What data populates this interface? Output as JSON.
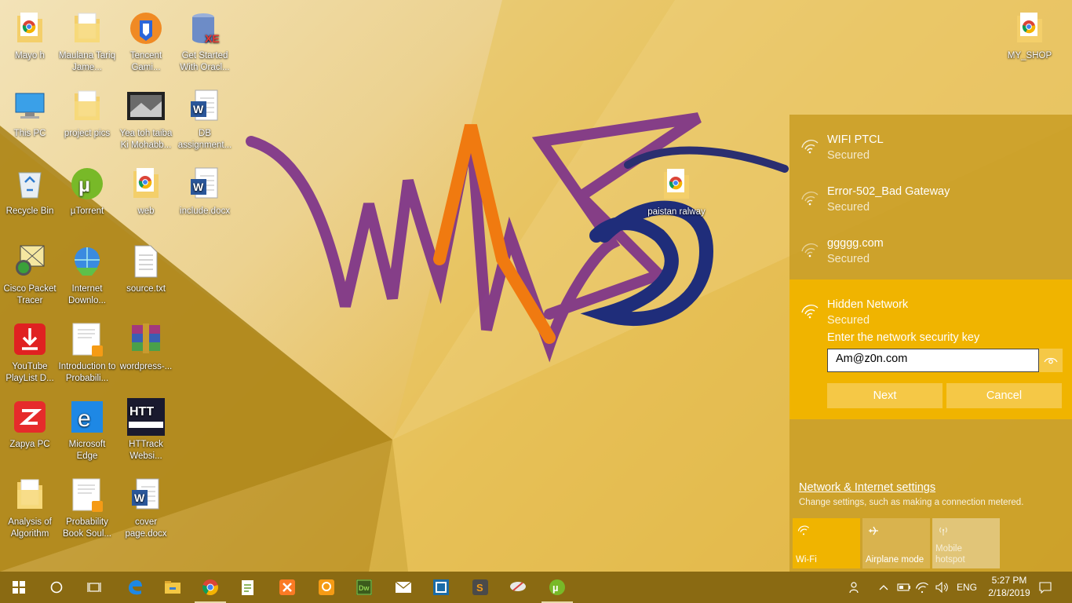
{
  "desktop": {
    "icons": [
      {
        "label": "Mayo h",
        "icon": "folder-chrome-icon"
      },
      {
        "label": "Maulana Tariq Jame...",
        "icon": "folder-icon"
      },
      {
        "label": "Tencent Gami...",
        "icon": "tencent-gaming-icon"
      },
      {
        "label": "Get Started With Oracl...",
        "icon": "oracle-xe-icon"
      },
      {
        "label": "This PC",
        "icon": "computer-icon"
      },
      {
        "label": "project pics",
        "icon": "folder-icon"
      },
      {
        "label": "Yea toh taiba Ki Mohabb...",
        "icon": "video-file-icon"
      },
      {
        "label": "DB assignment...",
        "icon": "word-doc-icon"
      },
      {
        "label": "Recycle Bin",
        "icon": "recycle-bin-icon"
      },
      {
        "label": "µTorrent",
        "icon": "utorrent-icon"
      },
      {
        "label": "web",
        "icon": "folder-chrome-icon"
      },
      {
        "label": "include.docx",
        "icon": "word-doc-icon"
      },
      {
        "label": "Cisco Packet Tracer",
        "icon": "cisco-packet-tracer-icon"
      },
      {
        "label": "Internet Downlo...",
        "icon": "idm-icon"
      },
      {
        "label": "source.txt",
        "icon": "text-file-icon"
      },
      {
        "label": "YouTube PlayList D...",
        "icon": "youtube-downloader-icon"
      },
      {
        "label": "Introduction to Probabili...",
        "icon": "pdf-doc-icon"
      },
      {
        "label": "wordpress-...",
        "icon": "winrar-icon"
      },
      {
        "label": "Zapya PC",
        "icon": "zapya-icon"
      },
      {
        "label": "Microsoft Edge",
        "icon": "edge-icon"
      },
      {
        "label": "HTTrack Websi...",
        "icon": "httrack-icon"
      },
      {
        "label": "Analysis of Algorithm",
        "icon": "folder-icon"
      },
      {
        "label": "Probability Book Soul...",
        "icon": "pdf-doc-icon"
      },
      {
        "label": "cover page.docx",
        "icon": "word-doc-icon"
      },
      {
        "label": "paistan ralway",
        "icon": "folder-chrome-icon"
      },
      {
        "label": "MY_SHOP",
        "icon": "folder-chrome-icon"
      }
    ]
  },
  "network": {
    "items": [
      {
        "ssid": "WIFI PTCL",
        "status": "Secured"
      },
      {
        "ssid": "Error-502_Bad Gateway",
        "status": "Secured"
      },
      {
        "ssid": "ggggg.com",
        "status": "Secured"
      },
      {
        "ssid": "Hidden Network",
        "status": "Secured"
      }
    ],
    "key_label": "Enter the network security key",
    "key_value": "Am@z0n.com",
    "next_label": "Next",
    "cancel_label": "Cancel",
    "settings_link": "Network & Internet settings",
    "settings_desc": "Change settings, such as making a connection metered.",
    "quick": {
      "wifi": "Wi-Fi",
      "airplane": "Airplane mode",
      "hotspot": "Mobile hotspot"
    }
  },
  "taskbar": {
    "apps": [
      "start-icon",
      "cortana-icon",
      "task-view-icon",
      "edge-icon",
      "file-explorer-icon",
      "chrome-icon",
      "notepad-plus-icon",
      "xampp-icon",
      "pdf-reader-icon",
      "dreamweaver-icon",
      "mail-icon",
      "app-icon",
      "sublime-icon",
      "snipping-icon",
      "utorrent-icon"
    ],
    "language": "ENG",
    "time": "5:27 PM",
    "date": "2/18/2019"
  },
  "colors": {
    "flyout": "#cb9f28",
    "selected": "#f0b400",
    "taskbar": "#8a6a12"
  }
}
